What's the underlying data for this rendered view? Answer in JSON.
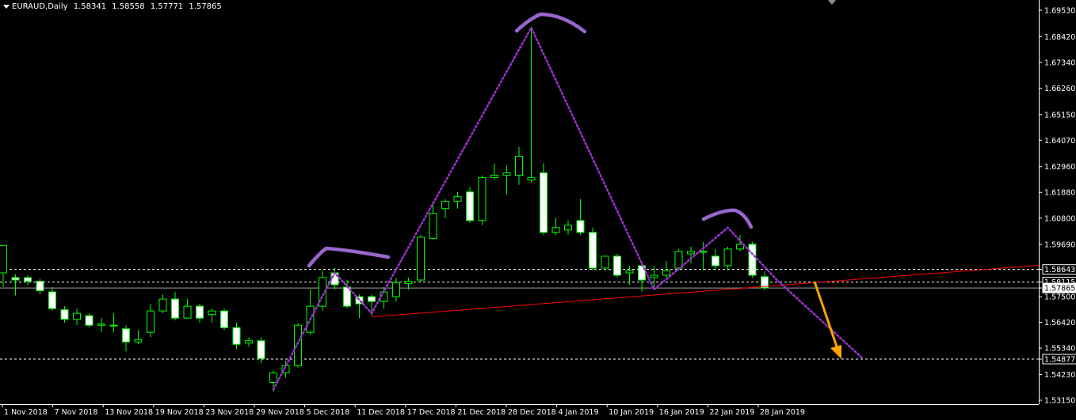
{
  "header": {
    "symbol": "EURAUD,Daily",
    "open": "1.58341",
    "high": "1.58558",
    "low": "1.57771",
    "close": "1.57865"
  },
  "colors": {
    "background": "#000000",
    "bull_body": "#000000",
    "bear_body": "#ffffff",
    "wick": "#00ff00",
    "pattern_line": "#9932cc",
    "pattern_arc": "#9966cc",
    "neckline": "#ff0000",
    "arrow": "#ffa500",
    "axis_text": "#ffffff",
    "grid_line": "#ffffff"
  },
  "chart_data": {
    "type": "candlestick",
    "y_axis": {
      "min": 1.5315,
      "max": 1.6953,
      "ticks": [
        "1.69530",
        "1.68420",
        "1.67340",
        "1.66260",
        "1.65150",
        "1.64070",
        "1.62960",
        "1.61880",
        "1.60800",
        "1.59690",
        "1.58643",
        "1.58115",
        "1.57865",
        "1.57500",
        "1.56420",
        "1.55340",
        "1.54877",
        "1.54230",
        "1.53150"
      ],
      "highlighted": [
        "1.58643",
        "1.58115",
        "1.57865",
        "1.54877"
      ]
    },
    "x_axis": {
      "labels": [
        "1 Nov 2018",
        "7 Nov 2018",
        "13 Nov 2018",
        "19 Nov 2018",
        "23 Nov 2018",
        "29 Nov 2018",
        "5 Dec 2018",
        "11 Dec 2018",
        "17 Dec 2018",
        "21 Dec 2018",
        "28 Dec 2018",
        "4 Jan 2019",
        "10 Jan 2019",
        "16 Jan 2019",
        "22 Jan 2019",
        "28 Jan 2019"
      ]
    },
    "horizontal_levels": [
      1.58643,
      1.58115,
      1.54877
    ],
    "current_price": 1.57865,
    "candles": [
      {
        "o": 1.585,
        "h": 1.596,
        "l": 1.579,
        "c": 1.5965
      },
      {
        "o": 1.583,
        "h": 1.5845,
        "l": 1.5755,
        "c": 1.582
      },
      {
        "o": 1.583,
        "h": 1.584,
        "l": 1.58,
        "c": 1.5815
      },
      {
        "o": 1.5815,
        "h": 1.5825,
        "l": 1.576,
        "c": 1.5775
      },
      {
        "o": 1.577,
        "h": 1.579,
        "l": 1.569,
        "c": 1.57
      },
      {
        "o": 1.5695,
        "h": 1.571,
        "l": 1.564,
        "c": 1.5655
      },
      {
        "o": 1.5655,
        "h": 1.57,
        "l": 1.563,
        "c": 1.568
      },
      {
        "o": 1.567,
        "h": 1.568,
        "l": 1.562,
        "c": 1.563
      },
      {
        "o": 1.563,
        "h": 1.566,
        "l": 1.56,
        "c": 1.5635
      },
      {
        "o": 1.563,
        "h": 1.568,
        "l": 1.56,
        "c": 1.563
      },
      {
        "o": 1.5615,
        "h": 1.563,
        "l": 1.552,
        "c": 1.556
      },
      {
        "o": 1.556,
        "h": 1.561,
        "l": 1.555,
        "c": 1.557
      },
      {
        "o": 1.56,
        "h": 1.572,
        "l": 1.558,
        "c": 1.569
      },
      {
        "o": 1.569,
        "h": 1.576,
        "l": 1.568,
        "c": 1.574
      },
      {
        "o": 1.574,
        "h": 1.577,
        "l": 1.565,
        "c": 1.566
      },
      {
        "o": 1.566,
        "h": 1.574,
        "l": 1.566,
        "c": 1.571
      },
      {
        "o": 1.571,
        "h": 1.572,
        "l": 1.564,
        "c": 1.566
      },
      {
        "o": 1.5675,
        "h": 1.57,
        "l": 1.564,
        "c": 1.569
      },
      {
        "o": 1.569,
        "h": 1.57,
        "l": 1.561,
        "c": 1.562
      },
      {
        "o": 1.562,
        "h": 1.564,
        "l": 1.553,
        "c": 1.555
      },
      {
        "o": 1.5555,
        "h": 1.558,
        "l": 1.554,
        "c": 1.5565
      },
      {
        "o": 1.5565,
        "h": 1.558,
        "l": 1.547,
        "c": 1.549
      },
      {
        "o": 1.539,
        "h": 1.544,
        "l": 1.535,
        "c": 1.543
      },
      {
        "o": 1.543,
        "h": 1.548,
        "l": 1.541,
        "c": 1.546
      },
      {
        "o": 1.546,
        "h": 1.564,
        "l": 1.545,
        "c": 1.563
      },
      {
        "o": 1.56,
        "h": 1.578,
        "l": 1.559,
        "c": 1.571
      },
      {
        "o": 1.571,
        "h": 1.586,
        "l": 1.569,
        "c": 1.583
      },
      {
        "o": 1.585,
        "h": 1.587,
        "l": 1.578,
        "c": 1.58
      },
      {
        "o": 1.579,
        "h": 1.582,
        "l": 1.57,
        "c": 1.571
      },
      {
        "o": 1.575,
        "h": 1.576,
        "l": 1.566,
        "c": 1.572
      },
      {
        "o": 1.575,
        "h": 1.576,
        "l": 1.567,
        "c": 1.573
      },
      {
        "o": 1.573,
        "h": 1.579,
        "l": 1.57,
        "c": 1.577
      },
      {
        "o": 1.575,
        "h": 1.583,
        "l": 1.573,
        "c": 1.581
      },
      {
        "o": 1.5805,
        "h": 1.583,
        "l": 1.578,
        "c": 1.5815
      },
      {
        "o": 1.582,
        "h": 1.601,
        "l": 1.581,
        "c": 1.6
      },
      {
        "o": 1.5995,
        "h": 1.614,
        "l": 1.599,
        "c": 1.61
      },
      {
        "o": 1.612,
        "h": 1.616,
        "l": 1.608,
        "c": 1.615
      },
      {
        "o": 1.615,
        "h": 1.619,
        "l": 1.612,
        "c": 1.617
      },
      {
        "o": 1.619,
        "h": 1.621,
        "l": 1.606,
        "c": 1.607
      },
      {
        "o": 1.607,
        "h": 1.626,
        "l": 1.605,
        "c": 1.625
      },
      {
        "o": 1.625,
        "h": 1.631,
        "l": 1.624,
        "c": 1.626
      },
      {
        "o": 1.626,
        "h": 1.63,
        "l": 1.618,
        "c": 1.627
      },
      {
        "o": 1.626,
        "h": 1.638,
        "l": 1.622,
        "c": 1.634
      },
      {
        "o": 1.624,
        "h": 1.6885,
        "l": 1.623,
        "c": 1.625
      },
      {
        "o": 1.627,
        "h": 1.631,
        "l": 1.601,
        "c": 1.602
      },
      {
        "o": 1.602,
        "h": 1.608,
        "l": 1.601,
        "c": 1.604
      },
      {
        "o": 1.603,
        "h": 1.607,
        "l": 1.601,
        "c": 1.605
      },
      {
        "o": 1.607,
        "h": 1.616,
        "l": 1.601,
        "c": 1.602
      },
      {
        "o": 1.602,
        "h": 1.604,
        "l": 1.586,
        "c": 1.587
      },
      {
        "o": 1.587,
        "h": 1.592,
        "l": 1.586,
        "c": 1.592
      },
      {
        "o": 1.592,
        "h": 1.593,
        "l": 1.583,
        "c": 1.584
      },
      {
        "o": 1.585,
        "h": 1.588,
        "l": 1.58,
        "c": 1.586
      },
      {
        "o": 1.588,
        "h": 1.589,
        "l": 1.577,
        "c": 1.582
      },
      {
        "o": 1.583,
        "h": 1.588,
        "l": 1.579,
        "c": 1.584
      },
      {
        "o": 1.584,
        "h": 1.59,
        "l": 1.583,
        "c": 1.586
      },
      {
        "o": 1.587,
        "h": 1.595,
        "l": 1.586,
        "c": 1.594
      },
      {
        "o": 1.593,
        "h": 1.596,
        "l": 1.589,
        "c": 1.594
      },
      {
        "o": 1.594,
        "h": 1.598,
        "l": 1.586,
        "c": 1.594
      },
      {
        "o": 1.592,
        "h": 1.595,
        "l": 1.586,
        "c": 1.588
      },
      {
        "o": 1.588,
        "h": 1.596,
        "l": 1.586,
        "c": 1.595
      },
      {
        "o": 1.595,
        "h": 1.601,
        "l": 1.594,
        "c": 1.597
      },
      {
        "o": 1.597,
        "h": 1.598,
        "l": 1.583,
        "c": 1.584
      },
      {
        "o": 1.5834,
        "h": 1.5856,
        "l": 1.5777,
        "c": 1.5787
      }
    ],
    "annotations": {
      "pattern": "head-and-shoulders",
      "neckline": [
        [
          1.5665,
          1.5882
        ]
      ],
      "zigzag": [
        1.536,
        1.585,
        1.568,
        1.688,
        1.578,
        1.604,
        1.582,
        1.549
      ]
    }
  }
}
